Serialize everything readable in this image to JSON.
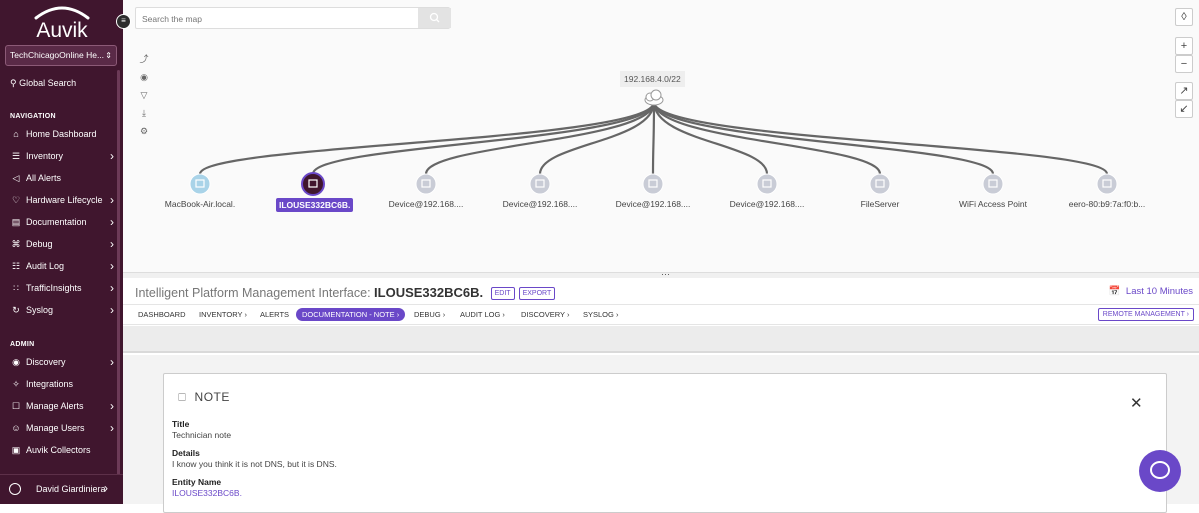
{
  "sidebar": {
    "logo_text": "Auvik",
    "tenant": "TechChicagoOnline He...",
    "global_search": "Global Search",
    "nav_section": "NAVIGATION",
    "nav": [
      {
        "label": "Home Dashboard",
        "icon": "home-icon"
      },
      {
        "label": "Inventory",
        "icon": "inventory-icon"
      },
      {
        "label": "All Alerts",
        "icon": "alerts-icon"
      },
      {
        "label": "Hardware Lifecycle",
        "icon": "lifecycle-icon"
      },
      {
        "label": "Documentation",
        "icon": "documentation-icon"
      },
      {
        "label": "Debug",
        "icon": "debug-icon"
      },
      {
        "label": "Audit Log",
        "icon": "audit-log-icon"
      },
      {
        "label": "TrafficInsights",
        "icon": "traffic-icon"
      },
      {
        "label": "Syslog",
        "icon": "syslog-icon"
      }
    ],
    "admin_section": "ADMIN",
    "admin": [
      {
        "label": "Discovery",
        "icon": "discovery-icon"
      },
      {
        "label": "Integrations",
        "icon": "integrations-icon"
      },
      {
        "label": "Manage Alerts",
        "icon": "manage-alerts-icon"
      },
      {
        "label": "Manage Users",
        "icon": "users-icon"
      },
      {
        "label": "Auvik Collectors",
        "icon": "collector-icon"
      }
    ],
    "user_name": "David Giardiniera"
  },
  "map": {
    "search_placeholder": "Search the map",
    "subnet_label": "192.168.4.0/22",
    "nodes": [
      {
        "label": "MacBook-Air.local.",
        "icon": "computer-icon",
        "selected": false
      },
      {
        "label": "ILOUSE332BC6B.",
        "icon": "ipmi-icon",
        "selected": true
      },
      {
        "label": "Device@192.168....",
        "icon": "device-icon",
        "selected": false
      },
      {
        "label": "Device@192.168....",
        "icon": "device-icon",
        "selected": false
      },
      {
        "label": "Device@192.168....",
        "icon": "device-icon",
        "selected": false
      },
      {
        "label": "Device@192.168....",
        "icon": "device-icon",
        "selected": false
      },
      {
        "label": "FileServer",
        "icon": "device-icon",
        "selected": false
      },
      {
        "label": "WiFi Access Point",
        "icon": "device-icon",
        "selected": false
      },
      {
        "label": "eero-80:b9:7a:f0:b...",
        "icon": "device-icon",
        "selected": false
      }
    ]
  },
  "detail": {
    "title_prefix": "Intelligent Platform Management Interface:",
    "title_name": "ILOUSE332BC6B.",
    "edit_label": "EDIT",
    "export_label": "EXPORT",
    "time_range": "Last 10 Minutes",
    "tabs": [
      {
        "label": "DASHBOARD",
        "chevron": false
      },
      {
        "label": "INVENTORY",
        "chevron": true
      },
      {
        "label": "ALERTS",
        "chevron": false
      },
      {
        "label": "DOCUMENTATION - NOTE",
        "chevron": true,
        "active": true
      },
      {
        "label": "DEBUG",
        "chevron": true
      },
      {
        "label": "AUDIT LOG",
        "chevron": true
      },
      {
        "label": "DISCOVERY",
        "chevron": true
      },
      {
        "label": "SYSLOG",
        "chevron": true
      }
    ],
    "remote_management": "REMOTE MANAGEMENT"
  },
  "note": {
    "heading": "NOTE",
    "title_label": "Title",
    "title_value": "Technician note",
    "details_label": "Details",
    "details_value": "I know you think it is not DNS, but it is DNS.",
    "entity_label": "Entity Name",
    "entity_value": "ILOUSE332BC6B."
  },
  "colors": {
    "brand": "#40162e",
    "accent": "#6a48c8"
  }
}
